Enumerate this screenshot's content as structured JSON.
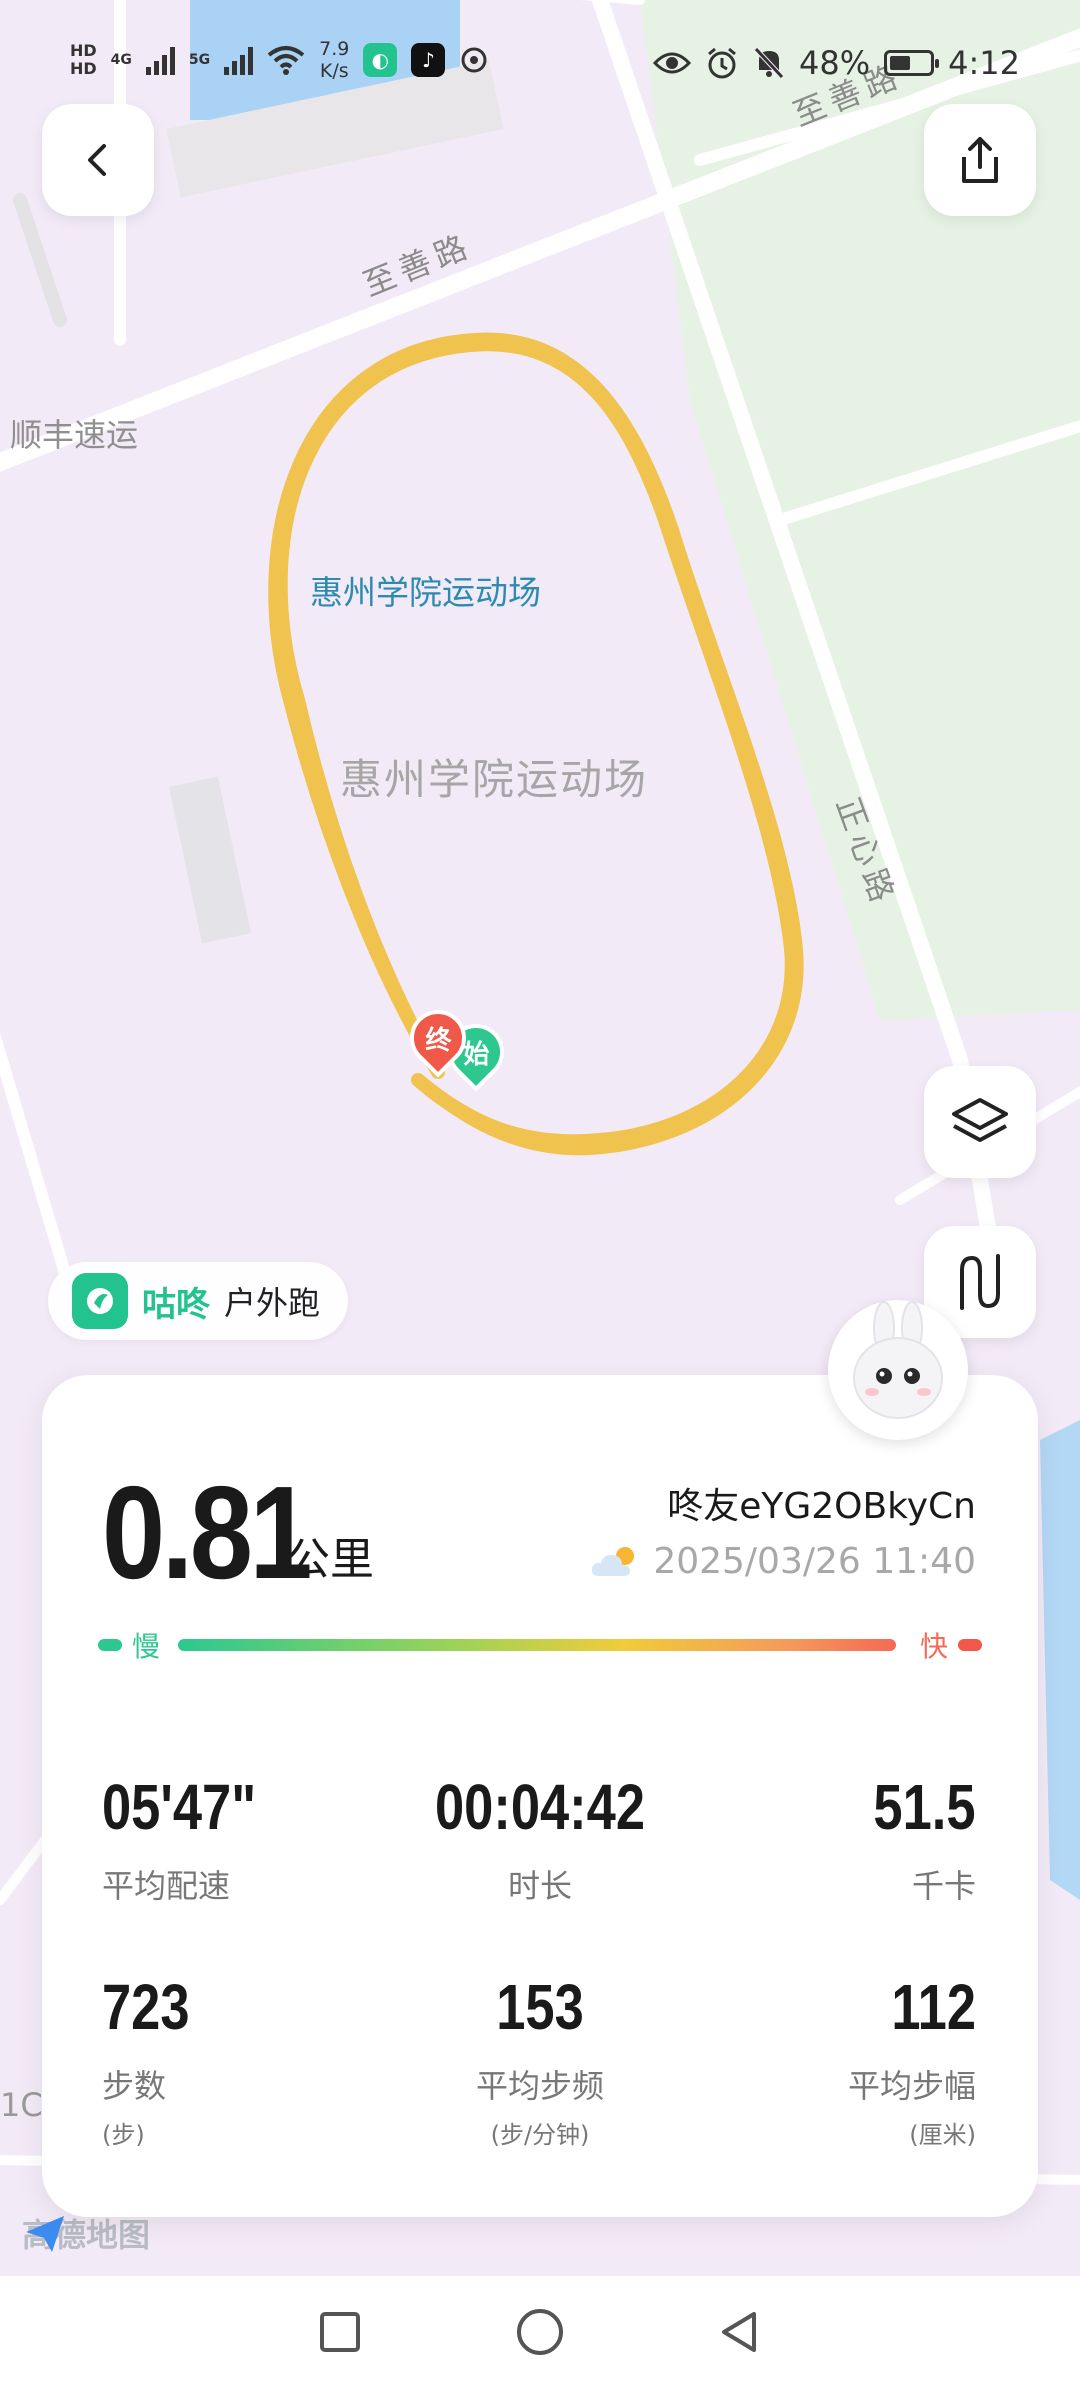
{
  "status_bar": {
    "hd1": "HD",
    "hd2": "HD",
    "sim1_net": "4G",
    "sim2_net": "5G",
    "net_speed_value": "7.9",
    "net_speed_unit": "K/s",
    "battery": "48%",
    "time": "4:12"
  },
  "map": {
    "roads": {
      "zhishan_top": "至善路",
      "zhishan_mid": "至善路",
      "zhengxin": "正心路"
    },
    "pois": {
      "sf": "顺丰速运",
      "stadium_poi": "惠州学院运动场",
      "stadium_area": "惠州学院运动场",
      "partial_code": "1C"
    },
    "markers": {
      "start": "始",
      "end": "终"
    },
    "attribution": "高德地图"
  },
  "app_badge": {
    "brand": "咕咚",
    "activity_type": "户外跑"
  },
  "summary": {
    "distance": "0.81",
    "distance_unit": "公里",
    "username": "咚友eYG2OBkyCn",
    "datetime": "2025/03/26 11:40",
    "pace_slow": "慢",
    "pace_fast": "快"
  },
  "stats": {
    "avg_pace": {
      "value": "05'47\"",
      "label": "平均配速"
    },
    "duration": {
      "value": "00:04:42",
      "label": "时长"
    },
    "calories": {
      "value": "51.5",
      "label": "千卡"
    },
    "steps": {
      "value": "723",
      "label": "步数",
      "unit": "(步)"
    },
    "cadence": {
      "value": "153",
      "label": "平均步频",
      "unit": "(步/分钟)"
    },
    "stride": {
      "value": "112",
      "label": "平均步幅",
      "unit": "(厘米)"
    }
  },
  "colors": {
    "route": "#f0c24e",
    "brand_green": "#22c38e",
    "end_marker": "#f0584a",
    "start_marker": "#2cc890"
  },
  "icons": {
    "back": "chevron-left-icon",
    "share": "share-icon",
    "layers": "layers-icon",
    "route_toggle": "route-icon"
  }
}
